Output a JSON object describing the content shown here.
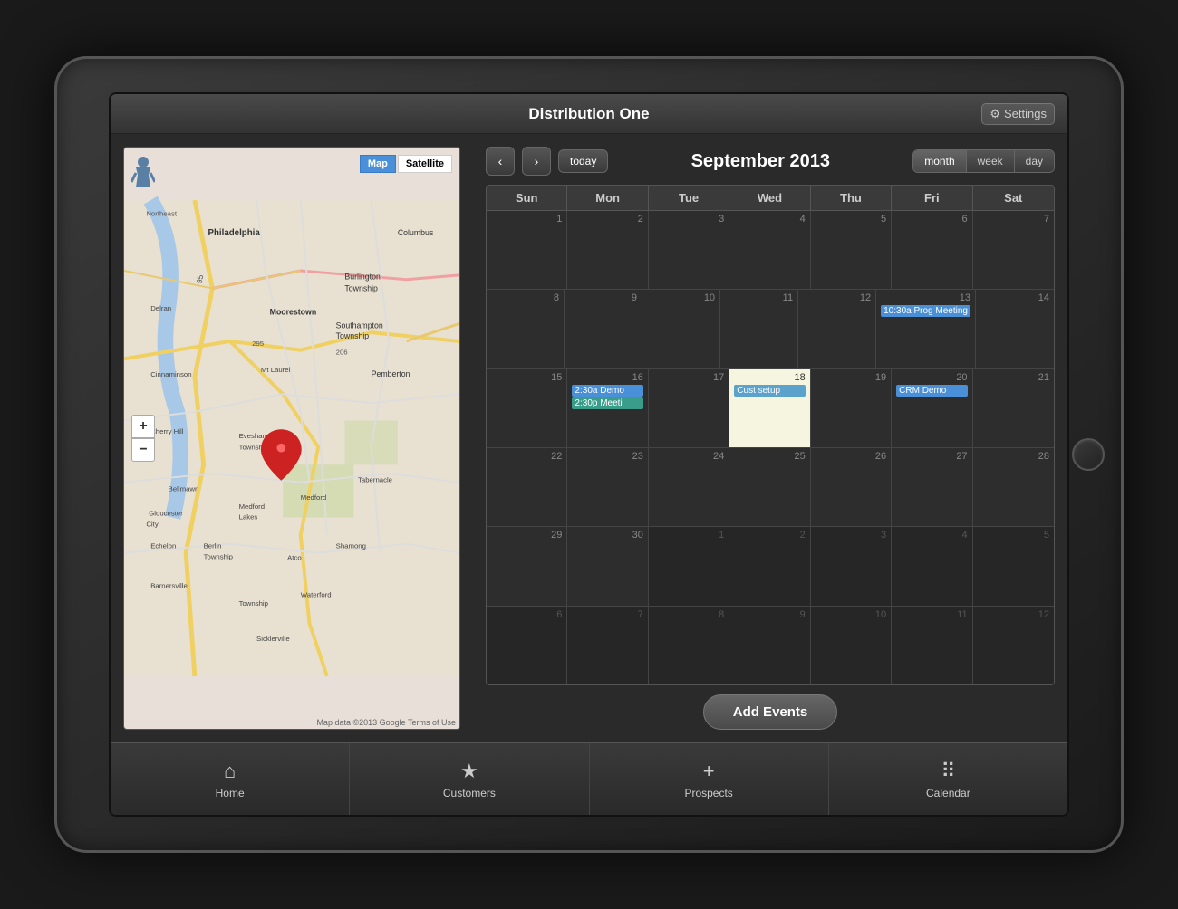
{
  "app": {
    "title": "Distribution One",
    "settings_label": "Settings"
  },
  "calendar": {
    "month_title": "September 2013",
    "view_buttons": [
      "month",
      "week",
      "day"
    ],
    "active_view": "month",
    "today_label": "today",
    "prev_label": "‹",
    "next_label": "›",
    "day_headers": [
      "Sun",
      "Mon",
      "Tue",
      "Wed",
      "Thu",
      "Fri",
      "Sat"
    ],
    "weeks": [
      {
        "days": [
          {
            "date": "1",
            "other": false,
            "today": false,
            "events": []
          },
          {
            "date": "2",
            "other": false,
            "today": false,
            "events": []
          },
          {
            "date": "3",
            "other": false,
            "today": false,
            "events": []
          },
          {
            "date": "4",
            "other": false,
            "today": false,
            "events": []
          },
          {
            "date": "5",
            "other": false,
            "today": false,
            "events": []
          },
          {
            "date": "6",
            "other": false,
            "today": false,
            "events": []
          },
          {
            "date": "7",
            "other": false,
            "today": false,
            "events": []
          }
        ]
      },
      {
        "days": [
          {
            "date": "8",
            "other": false,
            "today": false,
            "events": []
          },
          {
            "date": "9",
            "other": false,
            "today": false,
            "events": []
          },
          {
            "date": "10",
            "other": false,
            "today": false,
            "events": []
          },
          {
            "date": "11",
            "other": false,
            "today": false,
            "events": []
          },
          {
            "date": "12",
            "other": false,
            "today": false,
            "events": []
          },
          {
            "date": "13",
            "other": false,
            "today": false,
            "events": [
              {
                "label": "10:30a Prog Meeting",
                "type": "blue"
              }
            ]
          },
          {
            "date": "14",
            "other": false,
            "today": false,
            "events": []
          }
        ]
      },
      {
        "days": [
          {
            "date": "15",
            "other": false,
            "today": false,
            "events": []
          },
          {
            "date": "16",
            "other": false,
            "today": false,
            "events": [
              {
                "label": "2:30a Demo",
                "type": "blue"
              },
              {
                "label": "2:30p Meeti",
                "type": "teal"
              }
            ]
          },
          {
            "date": "17",
            "other": false,
            "today": false,
            "events": []
          },
          {
            "date": "18",
            "other": false,
            "today": true,
            "events": [
              {
                "label": "Cust setup",
                "type": "light-blue"
              }
            ]
          },
          {
            "date": "19",
            "other": false,
            "today": false,
            "events": []
          },
          {
            "date": "20",
            "other": false,
            "today": false,
            "events": [
              {
                "label": "CRM Demo",
                "type": "blue"
              }
            ]
          },
          {
            "date": "21",
            "other": false,
            "today": false,
            "events": []
          }
        ]
      },
      {
        "days": [
          {
            "date": "22",
            "other": false,
            "today": false,
            "events": []
          },
          {
            "date": "23",
            "other": false,
            "today": false,
            "events": []
          },
          {
            "date": "24",
            "other": false,
            "today": false,
            "events": []
          },
          {
            "date": "25",
            "other": false,
            "today": false,
            "events": []
          },
          {
            "date": "26",
            "other": false,
            "today": false,
            "events": []
          },
          {
            "date": "27",
            "other": false,
            "today": false,
            "events": []
          },
          {
            "date": "28",
            "other": false,
            "today": false,
            "events": []
          }
        ]
      },
      {
        "days": [
          {
            "date": "29",
            "other": false,
            "today": false,
            "events": []
          },
          {
            "date": "30",
            "other": false,
            "today": false,
            "events": []
          },
          {
            "date": "1",
            "other": true,
            "today": false,
            "events": []
          },
          {
            "date": "2",
            "other": true,
            "today": false,
            "events": []
          },
          {
            "date": "3",
            "other": true,
            "today": false,
            "events": []
          },
          {
            "date": "4",
            "other": true,
            "today": false,
            "events": []
          },
          {
            "date": "5",
            "other": true,
            "today": false,
            "events": []
          }
        ]
      },
      {
        "days": [
          {
            "date": "6",
            "other": true,
            "today": false,
            "events": []
          },
          {
            "date": "7",
            "other": true,
            "today": false,
            "events": []
          },
          {
            "date": "8",
            "other": true,
            "today": false,
            "events": []
          },
          {
            "date": "9",
            "other": true,
            "today": false,
            "events": []
          },
          {
            "date": "10",
            "other": true,
            "today": false,
            "events": []
          },
          {
            "date": "11",
            "other": true,
            "today": false,
            "events": []
          },
          {
            "date": "12",
            "other": true,
            "today": false,
            "events": []
          }
        ]
      }
    ],
    "add_events_label": "Add Events"
  },
  "map": {
    "map_btn": "Map",
    "satellite_btn": "Satellite",
    "zoom_in": "+",
    "zoom_out": "−",
    "attribution": "Map data ©2013 Google  Terms of Use"
  },
  "bottom_nav": {
    "items": [
      {
        "label": "Home",
        "icon": "⌂",
        "name": "home"
      },
      {
        "label": "Customers",
        "icon": "★",
        "name": "customers"
      },
      {
        "label": "Prospects",
        "icon": "+",
        "name": "prospects"
      },
      {
        "label": "Calendar",
        "icon": "⠿",
        "name": "calendar"
      }
    ]
  }
}
